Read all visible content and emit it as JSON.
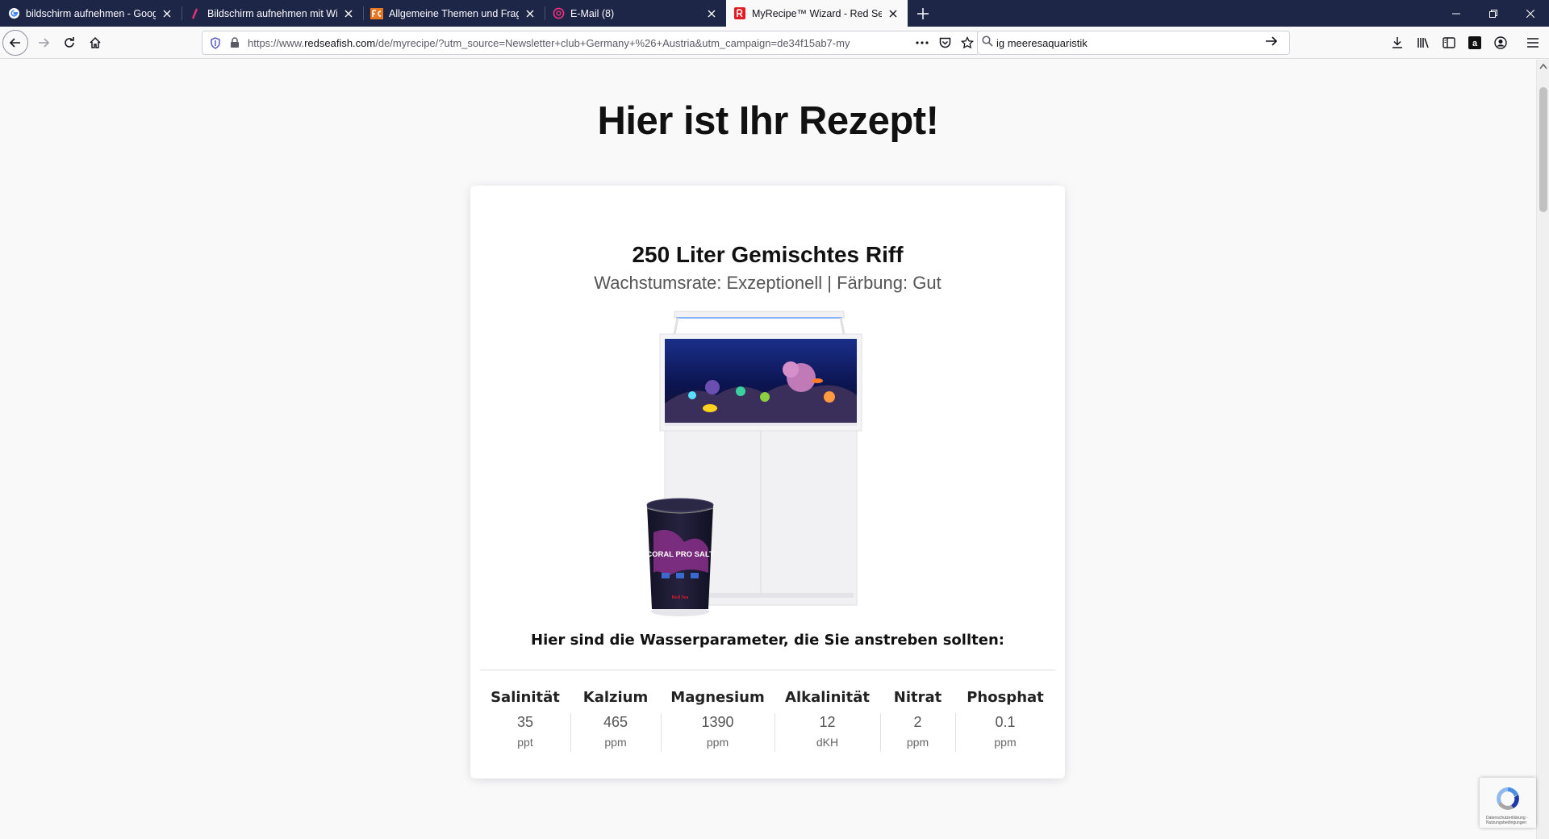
{
  "tabs": [
    {
      "title": "bildschirm aufnehmen - Google",
      "favicon": "google-icon",
      "active": false
    },
    {
      "title": "Bildschirm aufnehmen mit Windows",
      "favicon": "slash-icon",
      "active": false
    },
    {
      "title": "Allgemeine Themen und Fragen",
      "favicon": "forum-icon",
      "active": false
    },
    {
      "title": "E-Mail (8)",
      "favicon": "email-icon",
      "active": false
    },
    {
      "title": "MyRecipe™ Wizard - Red Sea",
      "favicon": "redsea-icon",
      "active": true
    }
  ],
  "url": {
    "prefix": "https://www.",
    "domain": "redseafish.com",
    "path": "/de/myrecipe/?utm_source=Newsletter+club+Germany+%26+Austria&utm_campaign=de34f15ab7-my"
  },
  "search": {
    "value": "ig meeresaquaristik"
  },
  "page": {
    "heading": "Hier ist Ihr Rezept!",
    "recipe_title": "250 Liter Gemischtes Riff",
    "recipe_subtitle": "Wachstumsrate: Exzeptionell | Färbung: Gut",
    "product_label": "CORAL PRO SALT",
    "product_brand": "Red Sea",
    "params_heading": "Hier sind die Wasserparameter, die Sie anstreben sollten:",
    "params": [
      {
        "name": "Salinität",
        "value": "35",
        "unit": "ppt"
      },
      {
        "name": "Kalzium",
        "value": "465",
        "unit": "ppm"
      },
      {
        "name": "Magnesium",
        "value": "1390",
        "unit": "ppm"
      },
      {
        "name": "Alkalinität",
        "value": "12",
        "unit": "dKH"
      },
      {
        "name": "Nitrat",
        "value": "2",
        "unit": "ppm"
      },
      {
        "name": "Phosphat",
        "value": "0.1",
        "unit": "ppm"
      }
    ]
  },
  "recaptcha": {
    "text": "Datenschutzerklärung - Nutzungsbedingungen"
  },
  "colors": {
    "tabbar": "#1e2648",
    "accent": "#e31b23"
  }
}
